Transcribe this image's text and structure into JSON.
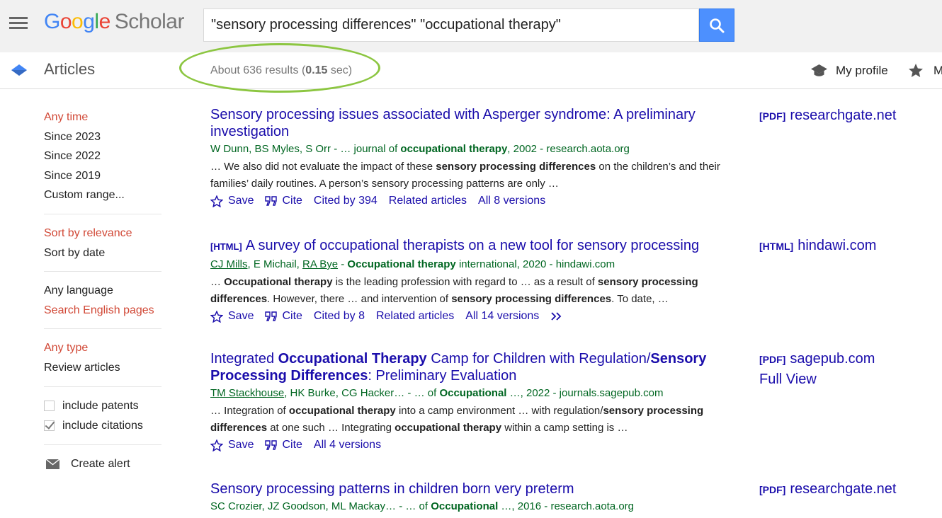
{
  "header": {
    "logo_letters": [
      "G",
      "o",
      "o",
      "g",
      "l",
      "e"
    ],
    "logo_product": "Scholar",
    "search_value": "\"sensory processing differences\" \"occupational therapy\""
  },
  "subbar": {
    "section_title": "Articles",
    "results_prefix": "About 636 results (",
    "results_time": "0.15",
    "results_suffix": " sec)",
    "my_profile": "My profile",
    "my_library": "My library"
  },
  "sidebar": {
    "time": [
      "Any time",
      "Since 2023",
      "Since 2022",
      "Since 2019",
      "Custom range..."
    ],
    "sort": [
      "Sort by relevance",
      "Sort by date"
    ],
    "language": [
      "Any language",
      "Search English pages"
    ],
    "type": [
      "Any type",
      "Review articles"
    ],
    "include_patents": "include patents",
    "include_citations": "include citations",
    "create_alert": "Create alert"
  },
  "results": [
    {
      "title": "Sensory processing issues associated with Asperger syndrome: A preliminary investigation",
      "meta_authors": "W Dunn, BS Myles, S Orr",
      "meta_sep": " - … journal of ",
      "meta_bold": "occupational therapy",
      "meta_rest": ", 2002 - research.aota.org",
      "snippet_a": "… We also did not evaluate the impact of these ",
      "snippet_b": "sensory processing differences",
      "snippet_c": " on the children’s and their families’ daily routines. A person’s sensory processing patterns are only …",
      "save": "Save",
      "cite": "Cite",
      "cited_by": "Cited by 394",
      "related": "Related articles",
      "versions": "All 8 versions",
      "side_tag": "[PDF]",
      "side_domain": "researchgate.net"
    },
    {
      "tag": "[HTML]",
      "title": "A survey of occupational therapists on a new tool for sensory processing",
      "author1": "CJ Mills",
      "author_sep1": ", E Michail, ",
      "author2": "RA Bye",
      "meta_sep": " - ",
      "meta_bold": "Occupational therapy",
      "meta_rest": " international, 2020 - hindawi.com",
      "snippet_a": "… ",
      "snippet_b": "Occupational therapy",
      "snippet_c": " is the leading profession with regard to … as a result of ",
      "snippet_d": "sensory processing differences",
      "snippet_e": ". However, there … and intervention of ",
      "snippet_f": "sensory processing differences",
      "snippet_g": ". To date, …",
      "save": "Save",
      "cite": "Cite",
      "cited_by": "Cited by 8",
      "related": "Related articles",
      "versions": "All 14 versions",
      "side_tag": "[HTML]",
      "side_domain": "hindawi.com"
    },
    {
      "title_a": "Integrated ",
      "title_b": "Occupational Therapy",
      "title_c": " Camp for Children with Regulation/",
      "title_d": "Sensory Processing Differences",
      "title_e": ": Preliminary Evaluation",
      "author1": "TM Stackhouse",
      "author_rest": ", HK Burke, CG Hacker…",
      "meta_sep": " - … of ",
      "meta_bold": "Occupational",
      "meta_rest": " …, 2022 - journals.sagepub.com",
      "snippet_a": "… Integration of ",
      "snippet_b": "occupational therapy",
      "snippet_c": " into a camp environment … with regulation/",
      "snippet_d": "sensory processing differences",
      "snippet_e": " at one such … Integrating ",
      "snippet_f": "occupational therapy",
      "snippet_g": " within a camp setting is …",
      "save": "Save",
      "cite": "Cite",
      "versions": "All 4 versions",
      "side_tag": "[PDF]",
      "side_domain": "sagepub.com",
      "side_extra": "Full View"
    },
    {
      "title": "Sensory processing patterns in children born very preterm",
      "meta_authors": "SC Crozier, JZ Goodson, ML Mackay…",
      "meta_sep": " - … of ",
      "meta_bold": "Occupational",
      "meta_rest": " …, 2016 - research.aota.org",
      "side_tag": "[PDF]",
      "side_domain": "researchgate.net"
    }
  ],
  "colors": {
    "link": "#1a0dab",
    "green": "#006621",
    "active": "#d14836",
    "accent_circle": "#8cc641"
  }
}
